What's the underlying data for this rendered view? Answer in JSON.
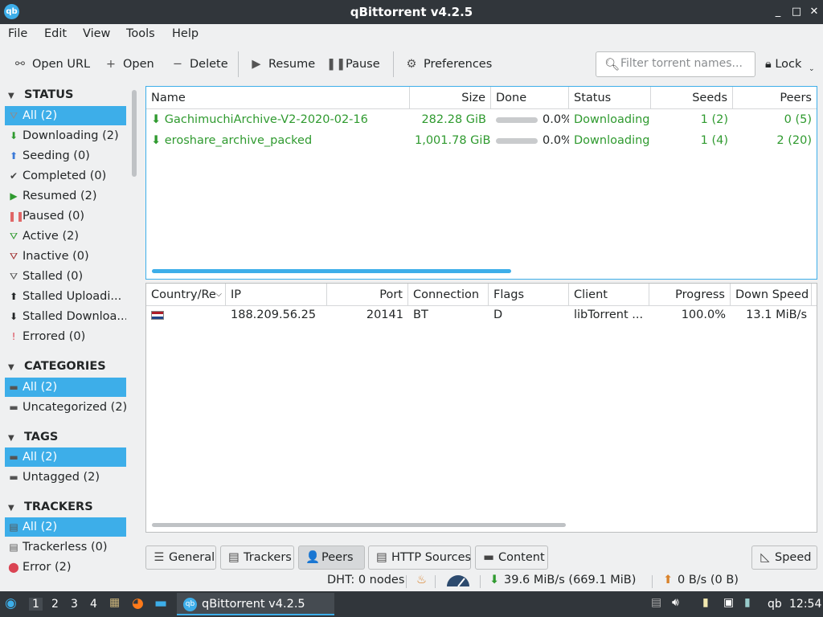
{
  "window": {
    "title": "qBittorrent v4.2.5",
    "icon_text": "qb",
    "minimize": "_",
    "maximize": "□",
    "close": "✕"
  },
  "menu": [
    "File",
    "Edit",
    "View",
    "Tools",
    "Help"
  ],
  "toolbar": {
    "open_url": "Open URL",
    "open": "Open",
    "delete": "Delete",
    "resume": "Resume",
    "pause": "Pause",
    "preferences": "Preferences",
    "filter_placeholder": "Filter torrent names...",
    "lock": "Lock"
  },
  "sidebar": {
    "status_title": "STATUS",
    "status": [
      {
        "label": "All (2)",
        "icon": "⛛",
        "color": "#8a8d90",
        "selected": true
      },
      {
        "label": "Downloading (2)",
        "icon": "⬇",
        "color": "#2f9a2f"
      },
      {
        "label": "Seeding (0)",
        "icon": "⬆",
        "color": "#3b7ad8"
      },
      {
        "label": "Completed (0)",
        "icon": "✔",
        "color": "#444"
      },
      {
        "label": "Resumed (2)",
        "icon": "▶",
        "color": "#2f9a2f"
      },
      {
        "label": "Paused (0)",
        "icon": "❚❚",
        "color": "#e06666"
      },
      {
        "label": "Active (2)",
        "icon": "⛛",
        "color": "#2f9a2f"
      },
      {
        "label": "Inactive (0)",
        "icon": "⛛",
        "color": "#a03030"
      },
      {
        "label": "Stalled (0)",
        "icon": "⛛",
        "color": "#555"
      },
      {
        "label": "Stalled Uploadi...",
        "icon": "⬆",
        "color": "#232627"
      },
      {
        "label": "Stalled Downloa...",
        "icon": "⬇",
        "color": "#232627"
      },
      {
        "label": "Errored (0)",
        "icon": "!",
        "color": "#da4453"
      }
    ],
    "categories_title": "CATEGORIES",
    "categories": [
      {
        "label": "All (2)",
        "selected": true
      },
      {
        "label": "Uncategorized (2)"
      }
    ],
    "tags_title": "TAGS",
    "tags": [
      {
        "label": "All (2)",
        "selected": true
      },
      {
        "label": "Untagged (2)"
      }
    ],
    "trackers_title": "TRACKERS",
    "trackers": [
      {
        "label": "All (2)",
        "selected": true
      },
      {
        "label": "Trackerless (0)"
      },
      {
        "label": "Error (2)"
      }
    ]
  },
  "torrents": {
    "headers": [
      "Name",
      "Size",
      "Done",
      "Status",
      "Seeds",
      "Peers"
    ],
    "rows": [
      {
        "name": "GachimuchiArchive-V2-2020-02-16",
        "size": "282.28 GiB",
        "progress": 0,
        "done": "0.0%",
        "status": "Downloading",
        "seeds": "1 (2)",
        "peers": "0 (5)"
      },
      {
        "name": "eroshare_archive_packed",
        "size": "1,001.78 GiB",
        "progress": 0,
        "done": "0.0%",
        "status": "Downloading",
        "seeds": "1 (4)",
        "peers": "2 (20)"
      }
    ]
  },
  "peers": {
    "headers": [
      "Country/Re",
      "IP",
      "Port",
      "Connection",
      "Flags",
      "Client",
      "Progress",
      "Down Speed"
    ],
    "rows": [
      {
        "country": "",
        "ip": "188.209.56.25",
        "port": "20141",
        "connection": "BT",
        "flags": "D",
        "client": "libTorrent ...",
        "progress": "100.0%",
        "down_speed": "13.1 MiB/s"
      }
    ]
  },
  "tabs": [
    {
      "label": "General",
      "icon": "☰"
    },
    {
      "label": "Trackers",
      "icon": "▤"
    },
    {
      "label": "Peers",
      "icon": "👤",
      "active": true
    },
    {
      "label": "HTTP Sources",
      "icon": "▤"
    },
    {
      "label": "Content",
      "icon": "▬"
    }
  ],
  "speed_button": "Speed",
  "statusbar": {
    "dht": "DHT: 0 nodes",
    "down": "39.6 MiB/s (669.1 MiB)",
    "up": "0 B/s (0 B)"
  },
  "taskbar": {
    "workspaces": [
      "1",
      "2",
      "3",
      "4"
    ],
    "task_label": "qBittorrent v4.2.5",
    "clock": "12:54",
    "tray_qb": "qb"
  },
  "colors": {
    "accent": "#3daee9",
    "downloading": "#2f9a2f",
    "titlebar": "#31363b"
  }
}
